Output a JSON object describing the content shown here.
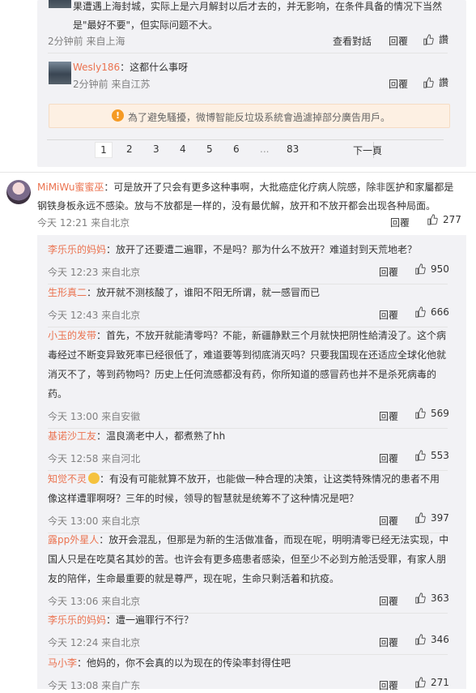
{
  "top_comment": {
    "text_line1": "果遭遇上海封城，实际上是六月解封以后才去的，并无影响，在条件具备的情况下当然",
    "text_line2": "是\"最好不要\"，但实际问题不大。",
    "meta": "2分钟前 来自上海",
    "view_dialog": "查看對話",
    "reply": "回覆",
    "like": "讚"
  },
  "sub_reply": {
    "name": "Wesly186",
    "text": "：这都什么事呀",
    "meta": "2分钟前 来自江苏",
    "reply": "回覆",
    "like": "讚"
  },
  "notice": {
    "icon": "warning-icon",
    "text": "為了避免騷擾，微博智能反垃圾系統會過濾掉部分廣告用戶。"
  },
  "pagination": {
    "pages": [
      "1",
      "2",
      "3",
      "4",
      "5",
      "6",
      "...",
      "83"
    ],
    "current": "1",
    "next": "下一頁"
  },
  "main_comment": {
    "name": "MiMiWu蜜蜜巫",
    "text_line1": "：可是放开了只会有更多这种事啊，大批癌症化疗病人院感，除非医护和家屬都是",
    "text_line2": "钢铁身板永远不感染。放与不放都是一样的，没有最优解，放开和不放开都会出现各种局面。",
    "meta": "今天 12:21 来自北京",
    "reply": "回覆",
    "likes": "277"
  },
  "replies": [
    {
      "name": "李乐乐的妈妈",
      "lines": [
        "：放开了还要遭二遍罪，不是吗？那为什么不放开？难道封到天荒地老？"
      ],
      "meta": "今天 12:23 来自北京",
      "reply": "回覆",
      "likes": "950"
    },
    {
      "name": "生形真二",
      "lines": [
        "：放开就不测核酸了，谁阳不阳无所谓，就一感冒而已"
      ],
      "meta": "今天 12:43 来自北京",
      "reply": "回覆",
      "likes": "666"
    },
    {
      "name": "小玉的发带",
      "lines": [
        "：首先，不放开就能清零吗？不能，新疆静默三个月就快把阴性給清没了。这个病",
        "毒经过不断变异致死率已经很低了，难道要等到彻底消灭吗？只要我国现在还适应全球化他就",
        "消灭不了，等到药物吗？历史上任何流感都没有药，你所知道的感冒药也并不是杀死病毒的",
        "药。"
      ],
      "meta": "今天 13:00 来自安徽",
      "reply": "回覆",
      "likes": "569"
    },
    {
      "name": "基诺沙工友",
      "lines": [
        "：温良滴老中人，都煮熟了hh"
      ],
      "meta": "今天 12:58 来自河北",
      "reply": "回覆",
      "likes": "553"
    },
    {
      "name": "知觉不灵",
      "lines": [
        "：有没有可能就算不放开，也能做一种合理的决策，让这类特殊情况的患者不用",
        "像这样遭罪啊呀？三年的时候，领导的智慧就是统筹不了这种情况是吧？"
      ],
      "meta": "今天 13:00 来自北京",
      "reply": "回覆",
      "likes": "397"
    },
    {
      "name": "露pp外星人",
      "lines": [
        "：放开会混乱，但那是为新的生活做准备，而现在呢，明明清零已经无法实现，中",
        "国人只是在吃莫名其妙的苦。也许会有更多癌患者感染，但至少不必到方舱活受罪，有家人朋",
        "友的陪伴，生命最重要的就是尊严，现在呢，生命只剩活着和抗疫。"
      ],
      "meta": "今天 13:06 来自北京",
      "reply": "回覆",
      "likes": "363"
    },
    {
      "name": "李乐乐的妈妈",
      "lines": [
        "：遭一遍罪行不行？"
      ],
      "meta": "今天 12:24 来自北京",
      "reply": "回覆",
      "likes": "346"
    },
    {
      "name": "马小李",
      "lines": [
        "：他妈的，你不会真的以为现在的传染率封得住吧"
      ],
      "meta": "今天 13:08 来自广东",
      "reply": "回覆",
      "likes": "271"
    }
  ]
}
